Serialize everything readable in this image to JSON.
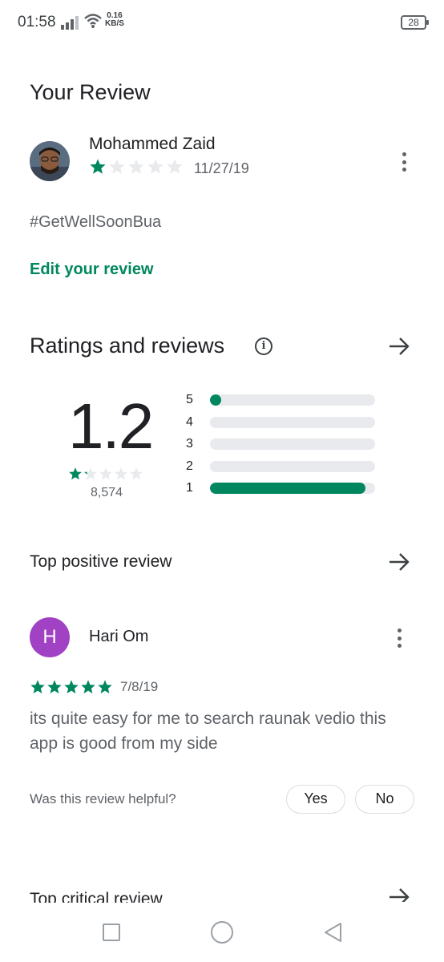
{
  "status_bar": {
    "time": "01:58",
    "speed_value": "0.16",
    "speed_unit": "KB/S",
    "battery": "28"
  },
  "your_review": {
    "title": "Your Review",
    "reviewer_name": "Mohammed Zaid",
    "stars": 1,
    "date": "11/27/19",
    "text": "#GetWellSoonBua",
    "edit_label": "Edit your review"
  },
  "ratings": {
    "title": "Ratings and reviews",
    "average": "1.2",
    "count": "8,574",
    "bar_labels": [
      "5",
      "4",
      "3",
      "2",
      "1"
    ],
    "bar_fractions": [
      0.04,
      0.0,
      0.0,
      0.0,
      0.94
    ]
  },
  "top_positive": {
    "title": "Top positive review",
    "avatar_letter": "H",
    "reviewer_name": "Hari Om",
    "stars": 5,
    "date": "7/8/19",
    "text": "its quite easy for me to search raunak vedio this app is good from my side",
    "helpful_question": "Was this review helpful?",
    "yes_label": "Yes",
    "no_label": "No"
  },
  "top_critical": {
    "title": "Top critical review"
  },
  "colors": {
    "accent_green": "#01875f",
    "avatar_purple": "#a142c4",
    "star_empty": "#e8eaed"
  }
}
